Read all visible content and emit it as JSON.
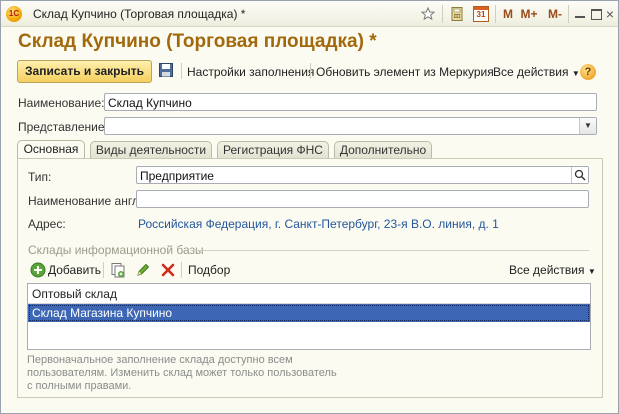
{
  "window": {
    "title": "Склад Купчино (Торговая площадка) *"
  },
  "toolbar": {
    "icons": [
      "star-icon",
      "calculator-icon",
      "calendar-icon",
      "memory-icons",
      "minimize-icon",
      "maximize-icon",
      "close-icon"
    ],
    "calendar_day": "31",
    "m": "M",
    "m_plus": "M+",
    "m_minus": "M-"
  },
  "form": {
    "title": "Склад Купчино (Торговая площадка) *"
  },
  "commands": {
    "save_close": "Записать и закрыть",
    "fill_settings": "Настройки заполнения",
    "update_mercury": "Обновить элемент из Меркурия",
    "all_actions": "Все действия"
  },
  "fields": {
    "name_label": "Наименование:",
    "name_value": "Склад Купчино",
    "representation_label": "Представление:",
    "representation_value": ""
  },
  "tabs": [
    {
      "label": "Основная",
      "active": true
    },
    {
      "label": "Виды деятельности",
      "active": false
    },
    {
      "label": "Регистрация ФНС",
      "active": false
    },
    {
      "label": "Дополнительно",
      "active": false
    }
  ],
  "main": {
    "type_label": "Тип:",
    "type_value": "Предприятие",
    "name_en_label": "Наименование англ:",
    "name_en_value": "",
    "address_label": "Адрес:",
    "address_value": "Российская Федерация, г. Санкт-Петербург, 23-я В.О. линия, д. 1"
  },
  "warehouses": {
    "group_title": "Склады информационной базы",
    "add": "Добавить",
    "pick": "Подбор",
    "all_actions": "Все действия",
    "rows": [
      {
        "name": "Оптовый склад",
        "selected": false
      },
      {
        "name": "Склад Магазина Купчино",
        "selected": true
      }
    ]
  },
  "hint": {
    "line1": "Первоначальное заполнение склада доступно всем",
    "line2": "пользователям. Изменить склад может только пользователь",
    "line3": "с полными правами."
  }
}
